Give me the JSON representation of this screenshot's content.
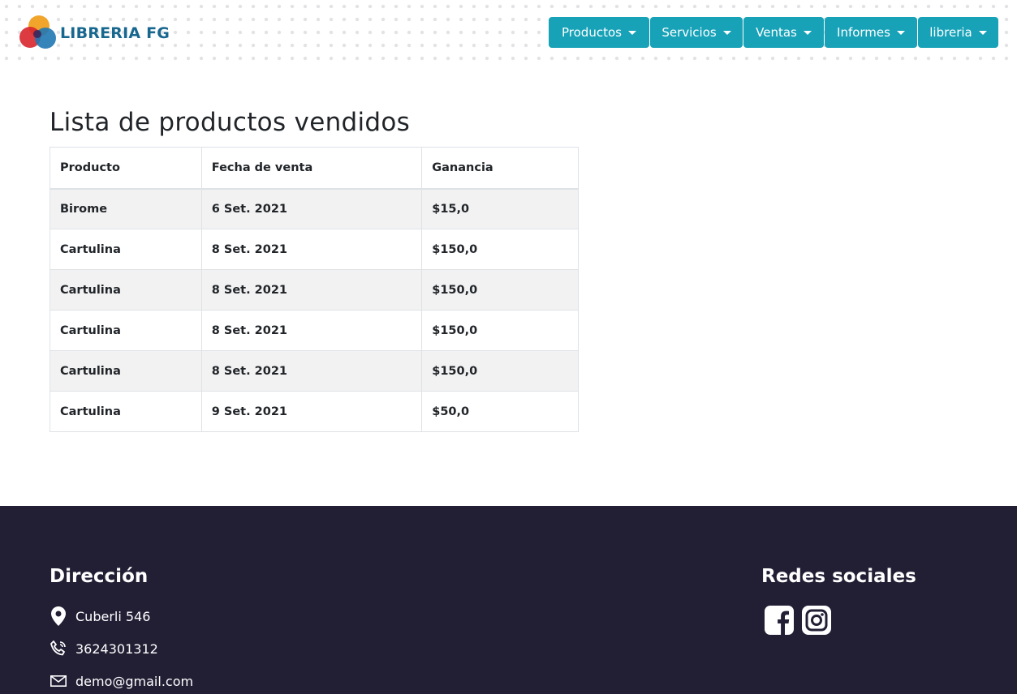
{
  "brand": {
    "name": "LIBRERIA FG",
    "accent": "#17a2b8",
    "logo_text_color": "#17678f"
  },
  "nav": [
    {
      "label": "Productos"
    },
    {
      "label": "Servicios"
    },
    {
      "label": "Ventas"
    },
    {
      "label": "Informes"
    },
    {
      "label": "libreria"
    }
  ],
  "main": {
    "title": "Lista de productos vendidos",
    "table": {
      "headers": [
        "Producto",
        "Fecha de venta",
        "Ganancia"
      ],
      "rows": [
        [
          "Birome",
          "6 Set. 2021",
          "$15,0"
        ],
        [
          "Cartulina",
          "8 Set. 2021",
          "$150,0"
        ],
        [
          "Cartulina",
          "8 Set. 2021",
          "$150,0"
        ],
        [
          "Cartulina",
          "8 Set. 2021",
          "$150,0"
        ],
        [
          "Cartulina",
          "8 Set. 2021",
          "$150,0"
        ],
        [
          "Cartulina",
          "9 Set. 2021",
          "$50,0"
        ]
      ]
    }
  },
  "footer": {
    "background": "#221f35",
    "address_title": "Dirección",
    "address": "Cuberli 546",
    "phone": "3624301312",
    "email": "demo@gmail.com",
    "social_title": "Redes sociales",
    "social_icons": [
      "facebook-icon",
      "instagram-icon"
    ]
  }
}
